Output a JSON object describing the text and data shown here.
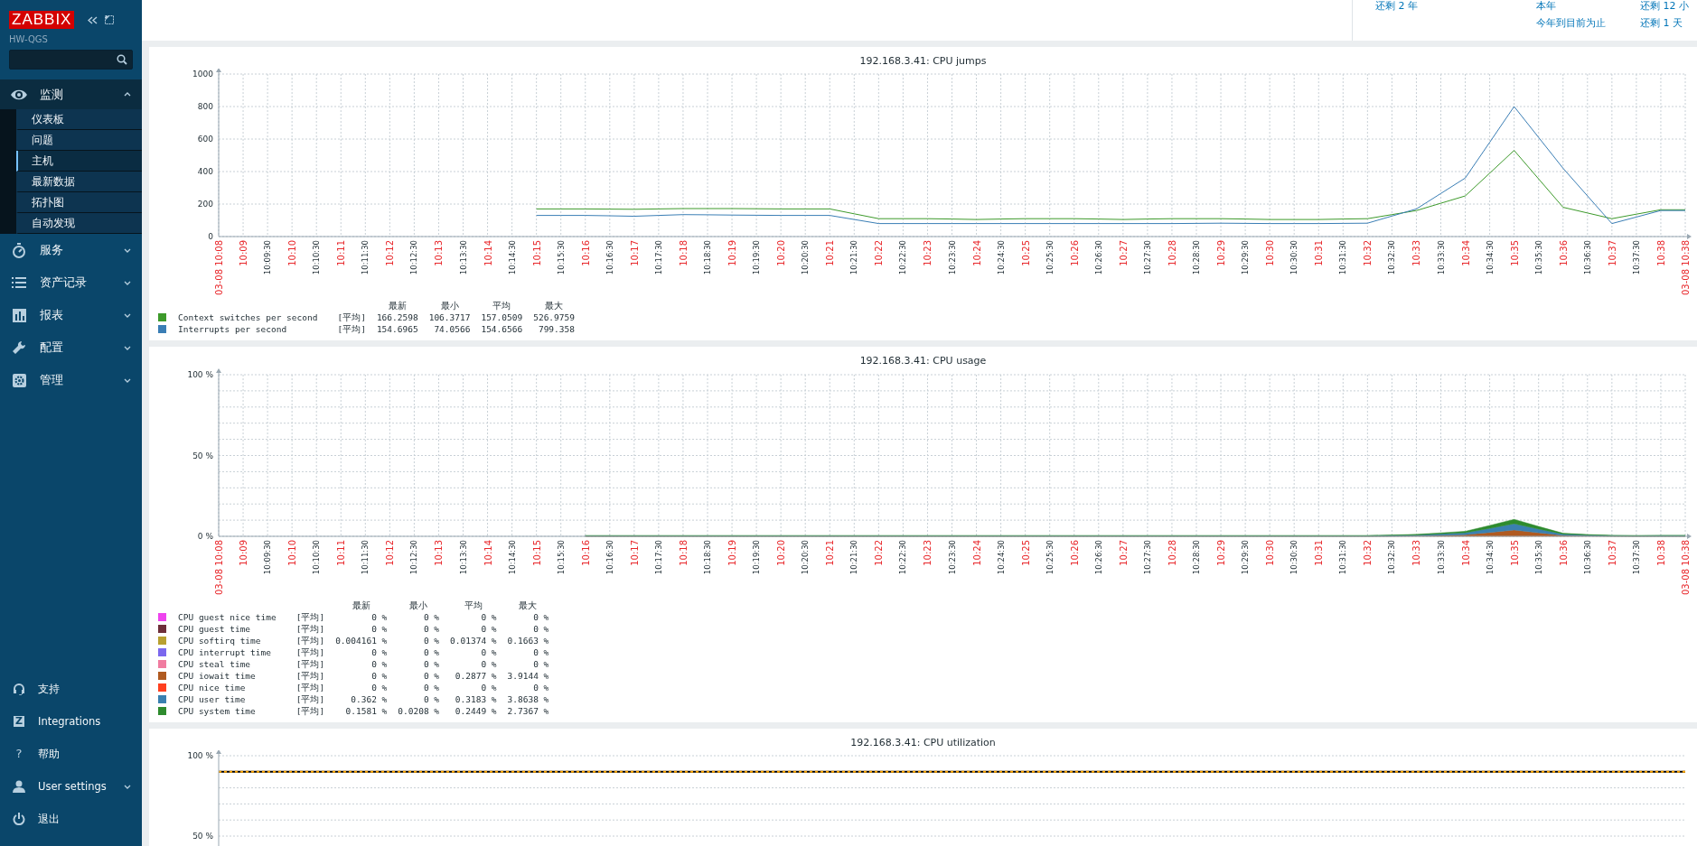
{
  "sidebar": {
    "logo": "ZABBIX",
    "server": "HW-QGS",
    "menu": [
      {
        "label": "监测",
        "expanded": true,
        "children": [
          {
            "label": "仪表板",
            "selected": false
          },
          {
            "label": "问题",
            "selected": false
          },
          {
            "label": "主机",
            "selected": true
          },
          {
            "label": "最新数据",
            "selected": false
          },
          {
            "label": "拓扑图",
            "selected": false
          },
          {
            "label": "自动发现",
            "selected": false
          }
        ]
      },
      {
        "label": "服务",
        "expanded": false
      },
      {
        "label": "资产记录",
        "expanded": false
      },
      {
        "label": "报表",
        "expanded": false
      },
      {
        "label": "配置",
        "expanded": false
      },
      {
        "label": "管理",
        "expanded": false
      }
    ],
    "footer_menu": [
      {
        "label": "支持",
        "kind": "link"
      },
      {
        "label": "Integrations",
        "kind": "link",
        "glyph": "Z"
      },
      {
        "label": "帮助",
        "kind": "link",
        "glyph": "?"
      },
      {
        "label": "User settings",
        "kind": "submenu"
      },
      {
        "label": "退出",
        "kind": "link"
      }
    ]
  },
  "time_ranges": {
    "column_1": [
      "还剩 2 年"
    ],
    "column_2": [
      "本年",
      "今年到目前为止"
    ],
    "column_3": [
      "还剩 12 小",
      "还剩 1 天"
    ]
  },
  "charts": [
    {
      "chart_data": {
        "type": "line",
        "grid": true,
        "title": "192.168.3.41: CPU jumps",
        "ylim": [
          0,
          1000
        ],
        "yticks": [
          0,
          200,
          400,
          600,
          800,
          1000
        ],
        "categories": [
          "03-08 10:08",
          "10:09",
          "10:09:30",
          "10:10",
          "10:10:30",
          "10:11",
          "10:11:30",
          "10:12",
          "10:12:30",
          "10:13",
          "10:13:30",
          "10:14",
          "10:14:30",
          "10:15",
          "10:15:30",
          "10:16",
          "10:16:30",
          "10:17",
          "10:17:30",
          "10:18",
          "10:18:30",
          "10:19",
          "10:19:30",
          "10:20",
          "10:20:30",
          "10:21",
          "10:21:30",
          "10:22",
          "10:22:30",
          "10:23",
          "10:23:30",
          "10:24",
          "10:24:30",
          "10:25",
          "10:25:30",
          "10:26",
          "10:26:30",
          "10:27",
          "10:27:30",
          "10:28",
          "10:28:30",
          "10:29",
          "10:29:30",
          "10:30",
          "10:30:30",
          "10:31",
          "10:31:30",
          "10:32",
          "10:32:30",
          "10:33",
          "10:33:30",
          "10:34",
          "10:34:30",
          "10:35",
          "10:35:30",
          "10:36",
          "10:36:30",
          "10:37",
          "10:37:30",
          "10:38",
          "03-08 10:38"
        ],
        "series": [
          {
            "name": "Context switches per second",
            "color": "#3d9a2b",
            "values": [
              null,
              null,
              null,
              null,
              null,
              null,
              null,
              null,
              null,
              null,
              null,
              null,
              null,
              170,
              170,
              170,
              169,
              168,
              170,
              172,
              172,
              172,
              171,
              170,
              170,
              170,
              140,
              110,
              110,
              110,
              108,
              105,
              108,
              110,
              110,
              110,
              108,
              105,
              108,
              110,
              110,
              110,
              108,
              105,
              105,
              105,
              108,
              110,
              135,
              160,
              205,
              250,
              390,
              530,
              355,
              180,
              145,
              110,
              138,
              165,
              165
            ]
          },
          {
            "name": "Interrupts per second",
            "color": "#3a7eb5",
            "values": [
              null,
              null,
              null,
              null,
              null,
              null,
              null,
              null,
              null,
              null,
              null,
              null,
              null,
              130,
              130,
              130,
              128,
              125,
              130,
              135,
              134,
              132,
              131,
              130,
              130,
              130,
              105,
              80,
              80,
              80,
              80,
              80,
              80,
              80,
              80,
              80,
              80,
              80,
              80,
              80,
              81,
              82,
              81,
              80,
              80,
              80,
              81,
              82,
              126,
              170,
              265,
              360,
              580,
              800,
              610,
              420,
              250,
              80,
              120,
              160,
              160
            ]
          }
        ]
      },
      "legend": {
        "headers": [
          "最新",
          "最小",
          "平均",
          "最大"
        ],
        "rows": [
          {
            "func": "[平均]",
            "latest": "166.2598",
            "min": "106.3717",
            "avg": "157.0509",
            "max": "526.9759"
          },
          {
            "func": "[平均]",
            "latest": "154.6965",
            "min": "74.0566",
            "avg": "154.6566",
            "max": "799.358"
          }
        ]
      }
    },
    {
      "chart_data": {
        "type": "area",
        "stacked": true,
        "grid": true,
        "title": "192.168.3.41: CPU usage",
        "ylim": [
          0,
          100
        ],
        "yticks": [
          {
            "value": 0,
            "label": "0 %"
          },
          {
            "value": 50,
            "label": "50 %"
          },
          {
            "value": 100,
            "label": "100 %"
          }
        ],
        "categories": [
          "03-08 10:08",
          "10:09",
          "10:09:30",
          "10:10",
          "10:10:30",
          "10:11",
          "10:11:30",
          "10:12",
          "10:12:30",
          "10:13",
          "10:13:30",
          "10:14",
          "10:14:30",
          "10:15",
          "10:15:30",
          "10:16",
          "10:16:30",
          "10:17",
          "10:17:30",
          "10:18",
          "10:18:30",
          "10:19",
          "10:19:30",
          "10:20",
          "10:20:30",
          "10:21",
          "10:21:30",
          "10:22",
          "10:22:30",
          "10:23",
          "10:23:30",
          "10:24",
          "10:24:30",
          "10:25",
          "10:25:30",
          "10:26",
          "10:26:30",
          "10:27",
          "10:27:30",
          "10:28",
          "10:28:30",
          "10:29",
          "10:29:30",
          "10:30",
          "10:30:30",
          "10:31",
          "10:31:30",
          "10:32",
          "10:32:30",
          "10:33",
          "10:33:30",
          "10:34",
          "10:34:30",
          "10:35",
          "10:35:30",
          "10:36",
          "10:36:30",
          "10:37",
          "10:37:30",
          "10:38",
          "03-08 10:38"
        ],
        "series": [
          {
            "name": "CPU iowait time",
            "color": "#b05a20",
            "values": [
              null,
              null,
              null,
              null,
              null,
              null,
              null,
              null,
              null,
              null,
              null,
              null,
              null,
              null,
              null,
              0,
              0,
              0,
              0,
              0,
              0,
              0,
              0,
              0,
              0,
              0,
              0,
              0,
              0,
              0,
              0,
              0,
              0,
              0,
              0,
              0,
              0,
              0,
              0,
              0,
              0,
              0,
              0,
              0,
              0,
              0,
              0,
              0,
              0.1,
              0.3,
              0.6,
              1,
              2.4,
              3.9,
              2.2,
              0.6,
              0.3,
              0.1,
              0,
              0,
              0
            ]
          },
          {
            "name": "CPU user time",
            "color": "#3a80b0",
            "values": [
              null,
              null,
              null,
              null,
              null,
              null,
              null,
              null,
              null,
              null,
              null,
              null,
              null,
              null,
              null,
              0.3,
              0.3,
              0.3,
              0.3,
              0.3,
              0.3,
              0.3,
              0.3,
              0.3,
              0.3,
              0.3,
              0.3,
              0.3,
              0.3,
              0.3,
              0.3,
              0.3,
              0.3,
              0.3,
              0.3,
              0.3,
              0.3,
              0.3,
              0.3,
              0.3,
              0.3,
              0.3,
              0.3,
              0.3,
              0.3,
              0.3,
              0.3,
              0.3,
              0.4,
              0.5,
              0.9,
              1.2,
              2.5,
              3.9,
              2.3,
              0.8,
              0.5,
              0.3,
              0.3,
              0.4,
              0.4
            ]
          },
          {
            "name": "CPU system time",
            "color": "#2e8b2e",
            "values": [
              null,
              null,
              null,
              null,
              null,
              null,
              null,
              null,
              null,
              null,
              null,
              null,
              null,
              null,
              null,
              0.2,
              0.2,
              0.2,
              0.2,
              0.2,
              0.2,
              0.2,
              0.2,
              0.2,
              0.2,
              0.2,
              0.2,
              0.2,
              0.2,
              0.2,
              0.2,
              0.2,
              0.2,
              0.2,
              0.2,
              0.2,
              0.2,
              0.2,
              0.2,
              0.2,
              0.2,
              0.2,
              0.2,
              0.2,
              0.2,
              0.2,
              0.2,
              0.2,
              0.3,
              0.4,
              0.6,
              0.9,
              1.8,
              2.7,
              1.6,
              0.5,
              0.3,
              0.2,
              0.2,
              0.2,
              0.2
            ]
          }
        ]
      },
      "legend": {
        "headers": [
          "最新",
          "最小",
          "平均",
          "最大"
        ],
        "rows": [
          {
            "kind": "flat",
            "name": "CPU guest nice time",
            "color": "#ee44ee",
            "func": "[平均]",
            "latest": "0 %",
            "min": "0 %",
            "avg": "0 %",
            "max": "0 %"
          },
          {
            "kind": "flat",
            "name": "CPU guest time",
            "color": "#6e2f3a",
            "func": "[平均]",
            "latest": "0 %",
            "min": "0 %",
            "avg": "0 %",
            "max": "0 %"
          },
          {
            "kind": "flat",
            "name": "CPU softirq time",
            "color": "#b8a030",
            "func": "[平均]",
            "latest": "0.004161 %",
            "min": "0 %",
            "avg": "0.01374 %",
            "max": "0.1663 %"
          },
          {
            "kind": "flat",
            "name": "CPU interrupt time",
            "color": "#7b68ee",
            "func": "[平均]",
            "latest": "0 %",
            "min": "0 %",
            "avg": "0 %",
            "max": "0 %"
          },
          {
            "kind": "flat",
            "name": "CPU steal time",
            "color": "#f07ca0",
            "func": "[平均]",
            "latest": "0 %",
            "min": "0 %",
            "avg": "0 %",
            "max": "0 %"
          },
          {
            "kind": "plotted",
            "func": "[平均]",
            "latest": "0 %",
            "min": "0 %",
            "avg": "0.2877 %",
            "max": "3.9144 %"
          },
          {
            "kind": "flat",
            "name": "CPU nice time",
            "color": "#ff4020",
            "func": "[平均]",
            "latest": "0 %",
            "min": "0 %",
            "avg": "0 %",
            "max": "0 %"
          },
          {
            "kind": "plotted",
            "func": "[平均]",
            "latest": "0.362 %",
            "min": "0 %",
            "avg": "0.3183 %",
            "max": "3.8638 %"
          },
          {
            "kind": "plotted",
            "func": "[平均]",
            "latest": "0.1581 %",
            "min": "0.0208 %",
            "avg": "0.2449 %",
            "max": "2.7367 %"
          }
        ]
      }
    },
    {
      "title": "192.168.3.41: CPU utilization",
      "y_labels": [
        "100 %",
        "50 %"
      ]
    }
  ]
}
